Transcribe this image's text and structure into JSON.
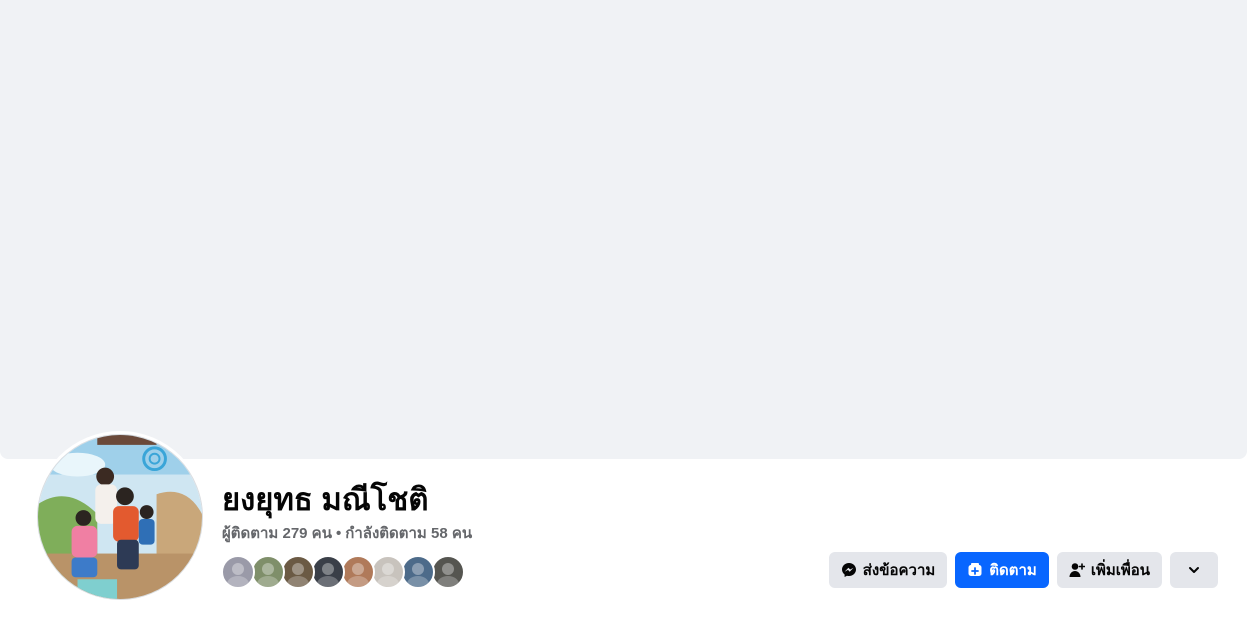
{
  "profile": {
    "name": "ยงยุทธ มณีโชติ",
    "followers_text": "ผู้ติดตาม 279 คน",
    "separator": "•",
    "following_text": "กำลังติดตาม 58 คน"
  },
  "friends": {
    "avatar_colors": [
      "#9a9aa8",
      "#7f8f6a",
      "#6b5a44",
      "#3a3f48",
      "#b07a5a",
      "#c8c3bd",
      "#4d6b8a",
      "#555550"
    ]
  },
  "actions": {
    "message_label": "ส่งข้อความ",
    "follow_label": "ติดตาม",
    "add_friend_label": "เพิ่มเพื่อน"
  },
  "colors": {
    "cover_bg": "#f0f2f5",
    "primary": "#0866ff",
    "secondary_btn": "#e4e6eb"
  },
  "icons": {
    "message": "messenger-icon",
    "follow": "follow-icon",
    "add_friend": "add-friend-icon",
    "more": "chevron-down-icon"
  }
}
